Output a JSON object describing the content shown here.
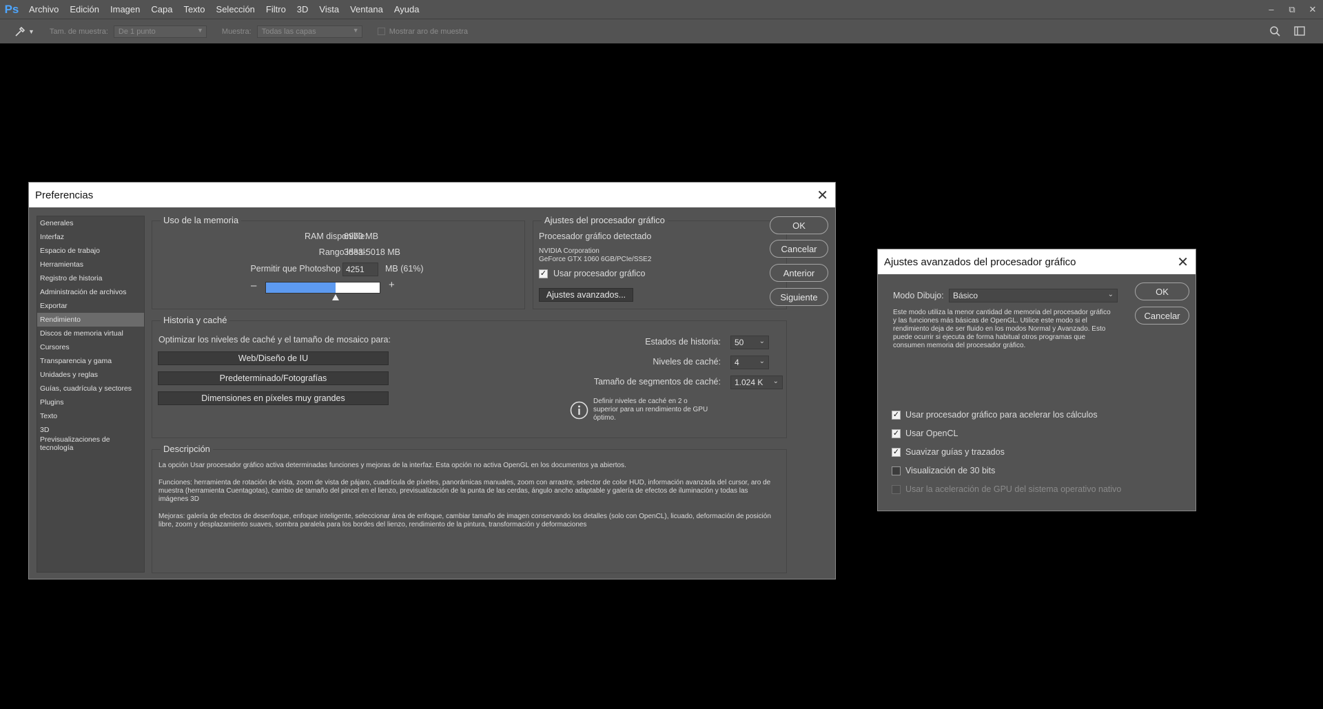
{
  "app": {
    "logo": "Ps",
    "menu": [
      "Archivo",
      "Edición",
      "Imagen",
      "Capa",
      "Texto",
      "Selección",
      "Filtro",
      "3D",
      "Vista",
      "Ventana",
      "Ayuda"
    ],
    "window_controls": {
      "minimize": "–",
      "restore": "⧉",
      "close": "✕"
    }
  },
  "options_bar": {
    "tool_icon": "eyedropper-icon",
    "sample_size_label": "Tam. de muestra:",
    "sample_size_value": "De 1 punto",
    "sample_label": "Muestra:",
    "sample_value": "Todas las capas",
    "show_ring_label": "Mostrar aro de muestra"
  },
  "prefs": {
    "title": "Preferencias",
    "sidebar": [
      "Generales",
      "Interfaz",
      "Espacio de trabajo",
      "Herramientas",
      "Registro de historia",
      "Administración de archivos",
      "Exportar",
      "Rendimiento",
      "Discos de memoria virtual",
      "Cursores",
      "Transparencia y gama",
      "Unidades y reglas",
      "Guías, cuadrícula y sectores",
      "Plugins",
      "Texto",
      "3D",
      "Previsualizaciones de tecnología"
    ],
    "active_section": "Rendimiento",
    "buttons": {
      "ok": "OK",
      "cancel": "Cancelar",
      "prev": "Anterior",
      "next": "Siguiente"
    },
    "memory": {
      "title": "Uso de la memoria",
      "ram_label": "RAM disponible:",
      "ram_value": "6970 MB",
      "ideal_label": "Rango ideal:",
      "ideal_value": "3833-5018 MB",
      "allow_label": "Permitir que Photoshop utilice:",
      "allow_value": "4251",
      "allow_unit": "MB (61%)",
      "minus": "–",
      "plus": "+",
      "usage_fraction": 0.61
    },
    "gpu": {
      "title": "Ajustes del procesador gráfico",
      "detected_label": "Procesador gráfico detectado",
      "vendor": "NVIDIA Corporation",
      "model": "GeForce GTX 1060 6GB/PCIe/SSE2",
      "use_gpu_label": "Usar procesador gráfico",
      "use_gpu_checked": true,
      "advanced_button": "Ajustes avanzados..."
    },
    "history": {
      "title": "Historia y caché",
      "optimize_label": "Optimizar los niveles de caché y el tamaño de mosaico para:",
      "presets": [
        "Web/Diseño de IU",
        "Predeterminado/Fotografías",
        "Dimensiones en píxeles muy grandes"
      ],
      "states_label": "Estados de historia:",
      "states_value": "50",
      "cache_levels_label": "Niveles de caché:",
      "cache_levels_value": "4",
      "tile_size_label": "Tamaño de segmentos de caché:",
      "tile_size_value": "1.024 K",
      "info_text": "Definir niveles de caché en 2 o superior para un rendimiento de GPU óptimo."
    },
    "description": {
      "title": "Descripción",
      "p1": "La opción Usar procesador gráfico activa determinadas funciones y mejoras de la interfaz. Esta opción no activa OpenGL en los documentos ya abiertos.",
      "p2": "Funciones: herramienta de rotación de vista, zoom de vista de pájaro, cuadrícula de píxeles, panorámicas manuales, zoom con arrastre, selector de color HUD, información avanzada del cursor, aro de muestra (herramienta Cuentagotas), cambio de tamaño del pincel en el lienzo, previsualización de la punta de las cerdas, ángulo ancho adaptable y galería de efectos de iluminación y todas las imágenes 3D",
      "p3": "Mejoras: galería de efectos de desenfoque, enfoque inteligente, seleccionar área de enfoque, cambiar tamaño de imagen conservando los detalles (solo con OpenCL), licuado, deformación de posición libre, zoom y desplazamiento suaves, sombra paralela para los bordes del lienzo, rendimiento de la pintura, transformación y deformaciones"
    }
  },
  "advanced": {
    "title": "Ajustes avanzados del procesador gráfico",
    "mode_label": "Modo Dibujo:",
    "mode_value": "Básico",
    "mode_desc": "Este modo utiliza la menor cantidad de memoria del procesador gráfico y las funciones más básicas de OpenGL. Utilice este modo si el rendimiento deja de ser fluido en los modos Normal y Avanzado. Esto puede ocurrir si ejecuta de forma habitual otros programas que consumen memoria del procesador gráfico.",
    "buttons": {
      "ok": "OK",
      "cancel": "Cancelar"
    },
    "options": [
      {
        "label": "Usar procesador gráfico para acelerar los cálculos",
        "checked": true,
        "disabled": false
      },
      {
        "label": "Usar OpenCL",
        "checked": true,
        "disabled": false
      },
      {
        "label": "Suavizar guías y trazados",
        "checked": true,
        "disabled": false
      },
      {
        "label": "Visualización de 30 bits",
        "checked": false,
        "disabled": false
      },
      {
        "label": "Usar la aceleración de GPU del sistema operativo nativo",
        "checked": false,
        "disabled": true
      }
    ]
  }
}
